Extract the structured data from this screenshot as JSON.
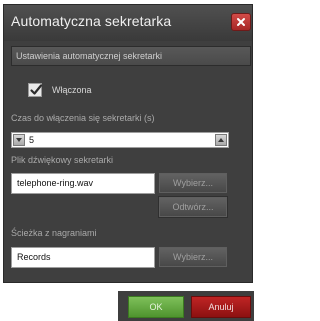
{
  "dialog": {
    "title": "Automatyczna sekretarka",
    "close_icon": "close-icon"
  },
  "section": {
    "title": "Ustawienia automatycznej sekretarki"
  },
  "enabled": {
    "label": "Włączona",
    "checked": true
  },
  "delay": {
    "label": "Czas do włączenia się sekretarki (s)",
    "value": "5"
  },
  "sound_file": {
    "label": "Plik dźwiękowy sekretarki",
    "value": "telephone-ring.wav",
    "choose_label": "Wybierz...",
    "play_label": "Odtwórz..."
  },
  "recordings": {
    "label": "Ścieżka z nagraniami",
    "value": "Records",
    "choose_label": "Wybierz..."
  },
  "footer": {
    "ok_label": "OK",
    "cancel_label": "Anuluj"
  },
  "colors": {
    "dialog_bg": "#3f3f3f",
    "close_red": "#c03634",
    "ok_green": "#5fa83b",
    "cancel_red": "#a51717"
  }
}
